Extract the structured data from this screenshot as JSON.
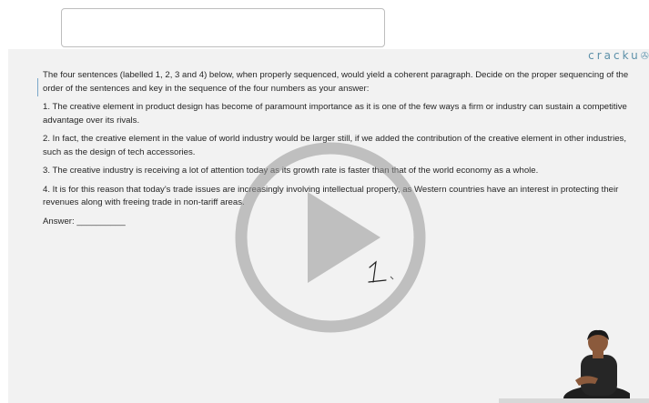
{
  "page": {
    "brand": "cracku",
    "instructions": "The four sentences (labelled 1, 2, 3 and 4) below, when properly sequenced, would yield a coherent paragraph. Decide on the proper sequencing of the order of the sentences and key in the sequence of the four numbers as your answer:",
    "sentences": [
      "1. The creative element in product design has become of paramount importance as it is one of the few ways a firm or industry can sustain a competitive advantage over its rivals.",
      "2. In fact, the creative element in the value of world industry would be larger still, if we added the contribution of the creative element in other industries, such as the design of tech accessories.",
      "3. The creative industry is receiving a lot of attention today as its growth rate is faster than that of the world economy as a whole.",
      "4. It is for this reason that today's trade issues are increasingly involving intellectual property, as Western countries have an interest in protecting their revenues along with freeing trade in non-tariff areas."
    ],
    "answer_label": "Answer: __________",
    "handwriting": "1"
  },
  "colors": {
    "brand": "#5b8fa8",
    "slide_bg": "#f2f2f2",
    "play_overlay": "rgba(150,150,150,0.55)"
  },
  "icons": {
    "play": "play-icon"
  }
}
